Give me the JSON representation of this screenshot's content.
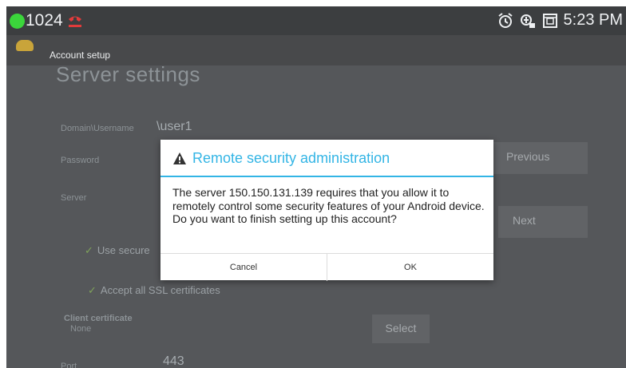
{
  "status_bar": {
    "notification_count": "1024",
    "time": "5:23 PM",
    "icons": [
      "green-dot-icon",
      "missed-call-icon",
      "alarm-icon",
      "data-sync-icon",
      "screen-icon"
    ]
  },
  "action_bar": {
    "title": "Account setup"
  },
  "form": {
    "heading": "Server settings",
    "domain_label": "Domain\\Username",
    "domain_value": "\\user1",
    "password_label": "Password",
    "server_label": "Server",
    "use_secure_label": "Use secure",
    "accept_ssl_label": "Accept all SSL certificates",
    "client_cert_label": "Client certificate",
    "client_cert_value": "None",
    "select_label": "Select",
    "port_label": "Port",
    "port_value": "443",
    "previous_label": "Previous",
    "next_label": "Next"
  },
  "dialog": {
    "title": "Remote security administration",
    "message": "The server 150.150.131.139 requires that you allow it to remotely control some security features of your Android device. Do you want to finish setting up this account?",
    "cancel_label": "Cancel",
    "ok_label": "OK"
  },
  "colors": {
    "dialog_accent": "#33b5e5",
    "status_dot": "#3bd63b",
    "missed_call": "#e23b3b"
  }
}
